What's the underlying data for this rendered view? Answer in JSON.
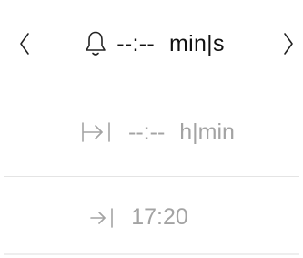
{
  "nav": {
    "prev_icon": "chevron-left-icon",
    "next_icon": "chevron-right-icon"
  },
  "alarm": {
    "icon": "bell-icon",
    "value": "--:--",
    "unit": "min|s"
  },
  "duration": {
    "icon": "bar-arrow-bar-icon",
    "value": "--:--",
    "unit": "h|min"
  },
  "end_time": {
    "icon": "arrow-to-bar-icon",
    "value": "17:20"
  },
  "colors": {
    "primary_text": "#111111",
    "secondary_text": "#a3a3a3",
    "divider": "#e4e4e4"
  }
}
